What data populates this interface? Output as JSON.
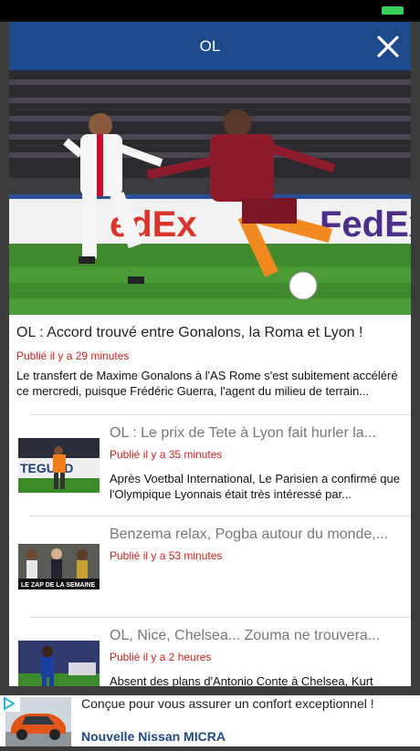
{
  "header": {
    "title": "OL"
  },
  "featured": {
    "title": "OL : Accord trouvé entre Gonalons, la Roma et Lyon !",
    "time": "Publié il y a 29 minutes",
    "summary": "Le transfert de Maxime Gonalons à l'AS Rome s'est subitement accéléré ce mercredi, puisque Frédéric Guerra, l'agent du milieu de terrain..."
  },
  "articles": [
    {
      "title": "OL : Le prix de Tete à Lyon fait hurler la...",
      "time": "Publié il y a 35 minutes",
      "summary": "Après Voetbal International, Le Parisien a confirmé que l'Olympique Lyonnais était très intéressé par...",
      "thumb_text": "TEGUED"
    },
    {
      "title": "Benzema relax, Pogba autour du monde,...",
      "time": "Publié il y a 53 minutes",
      "summary": "",
      "thumb_text": "LE ZAP DE LA SEMAINE"
    },
    {
      "title": "OL, Nice, Chelsea... Zouma ne trouvera...",
      "time": "Publié il y a 2 heures",
      "summary": "Absent des plans d'Antonio Conte à Chelsea, Kurt"
    }
  ],
  "ad": {
    "text": "Conçue pour vous assurer un confort exceptionnel !",
    "brand": "Nouvelle Nissan MICRA"
  },
  "colors": {
    "header_bg": "#1c4a8b",
    "time_text": "#d2241c",
    "ad_brand": "#1f4a80",
    "battery": "#36d05a"
  }
}
